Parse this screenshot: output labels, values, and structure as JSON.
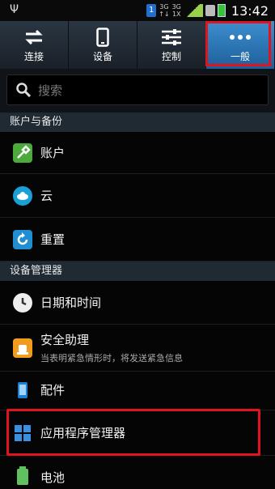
{
  "status_bar": {
    "usb_icon": "usb-icon",
    "sim_number": "1",
    "net1": {
      "top": "3G",
      "bottom": "↑↓"
    },
    "net2": {
      "top": "3G",
      "bottom": "1X"
    },
    "time": "13:42"
  },
  "tabs": [
    {
      "label": "连接",
      "icon": "connections-icon",
      "active": false
    },
    {
      "label": "设备",
      "icon": "device-icon",
      "active": false
    },
    {
      "label": "控制",
      "icon": "controls-icon",
      "active": false
    },
    {
      "label": "一般",
      "icon": "more-icon",
      "active": true
    }
  ],
  "search": {
    "placeholder": "搜索"
  },
  "sections": [
    {
      "title": "账户与备份"
    },
    {
      "title": "设备管理器"
    }
  ],
  "items": {
    "accounts": {
      "label": "账户"
    },
    "cloud": {
      "label": "云"
    },
    "reset": {
      "label": "重置"
    },
    "datetime": {
      "label": "日期和时间"
    },
    "safety": {
      "label": "安全助理",
      "sub": "当表明紧急情形时，将发送紧急信息"
    },
    "accessories": {
      "label": "配件"
    },
    "appmanager": {
      "label": "应用程序管理器"
    },
    "battery": {
      "label": "电池"
    }
  },
  "colors": {
    "accent": "#3d8fcf",
    "highlight": "#e0141f"
  }
}
